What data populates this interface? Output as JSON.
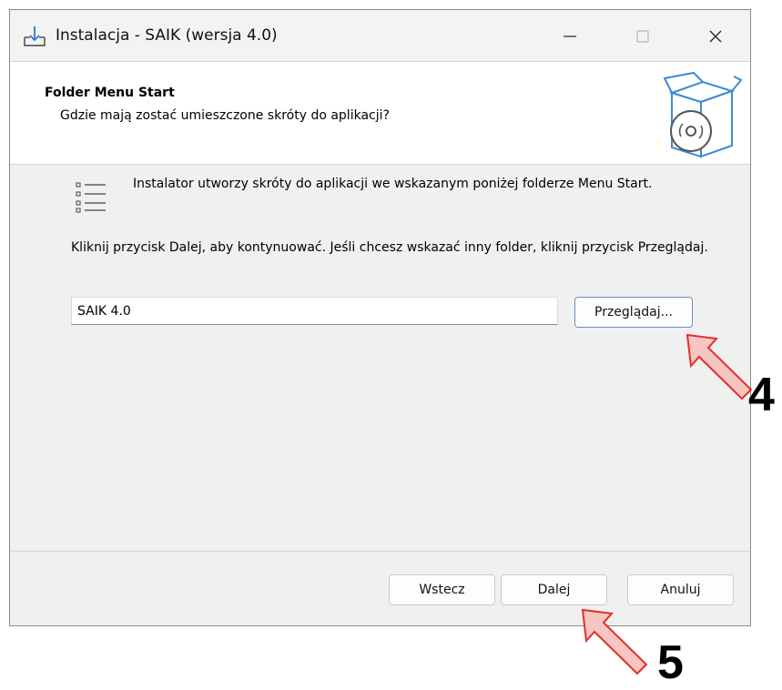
{
  "window": {
    "title": "Instalacja - SAIK (wersja 4.0)",
    "controls": [
      "minimize-icon",
      "maximize-icon",
      "close-icon"
    ]
  },
  "header": {
    "title": "Folder Menu Start",
    "subtitle": "Gdzie mają zostać umieszczone skróty do aplikacji?"
  },
  "body": {
    "info_text": "Instalator utworzy skróty do aplikacji we wskazanym poniżej folderze Menu Start.",
    "instruction_text": "Kliknij przycisk Dalej, aby kontynuować. Jeśli chcesz wskazać inny folder, kliknij przycisk Przeglądaj.",
    "folder_value": "SAIK 4.0",
    "browse_label": "Przeglądaj..."
  },
  "footer": {
    "back_label": "Wstecz",
    "next_label": "Dalej",
    "cancel_label": "Anuluj"
  },
  "annotations": [
    {
      "label": "4",
      "color": "#e0302a"
    },
    {
      "label": "5",
      "color": "#e0302a"
    }
  ],
  "colors": {
    "arrow_fill": "#f7c6c3",
    "arrow_stroke": "#e0302a",
    "accent_blue": "#3a8ad6"
  }
}
